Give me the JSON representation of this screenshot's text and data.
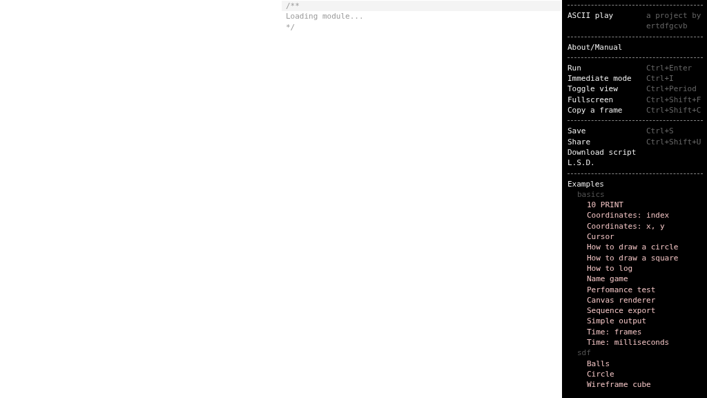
{
  "editor": {
    "lines": [
      "/**",
      "Loading module...",
      "*/"
    ]
  },
  "sidebar": {
    "title": "ASCII play",
    "byline": [
      "a project by",
      "ertdfgcvb"
    ],
    "sections": [
      [
        {
          "label": "About/Manual"
        }
      ],
      [
        {
          "label": "Run",
          "shortcut": "Ctrl+Enter"
        },
        {
          "label": "Immediate mode",
          "shortcut": "Ctrl+I"
        },
        {
          "label": "Toggle view",
          "shortcut": "Ctrl+Period"
        },
        {
          "label": "Fullscreen",
          "shortcut": "Ctrl+Shift+F"
        },
        {
          "label": "Copy a frame",
          "shortcut": "Ctrl+Shift+C"
        }
      ],
      [
        {
          "label": "Save",
          "shortcut": "Ctrl+S"
        },
        {
          "label": "Share",
          "shortcut": "Ctrl+Shift+U"
        },
        {
          "label": "Download script"
        },
        {
          "label": "L.S.D."
        }
      ]
    ],
    "examples": {
      "label": "Examples",
      "children": [
        {
          "label": "basics",
          "children": [
            {
              "label": "10 PRINT"
            },
            {
              "label": "Coordinates: index"
            },
            {
              "label": "Coordinates: x, y"
            },
            {
              "label": "Cursor"
            },
            {
              "label": "How to draw a circle"
            },
            {
              "label": "How to draw a square"
            },
            {
              "label": "How to log"
            },
            {
              "label": "Name game"
            },
            {
              "label": "Perfomance test"
            },
            {
              "label": "Canvas renderer"
            },
            {
              "label": "Sequence export"
            },
            {
              "label": "Simple output"
            },
            {
              "label": "Time: frames"
            },
            {
              "label": "Time: milliseconds"
            }
          ]
        },
        {
          "label": "sdf",
          "children": [
            {
              "label": "Balls"
            },
            {
              "label": "Circle"
            },
            {
              "label": "Wireframe cube"
            }
          ]
        }
      ]
    }
  }
}
